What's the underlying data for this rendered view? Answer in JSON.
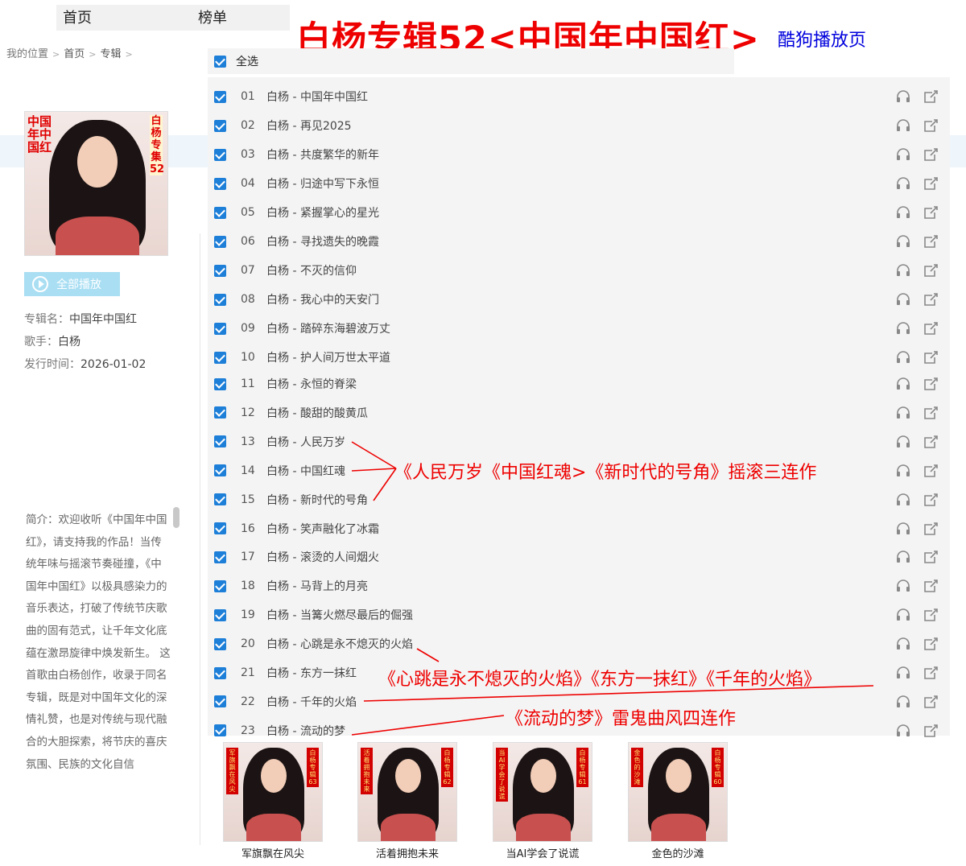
{
  "nav": {
    "home": "首页",
    "charts": "榜单"
  },
  "header": {
    "title": "白杨专辑52<中国年中国红>",
    "page_tag": "酷狗播放页"
  },
  "breadcrumb": {
    "location": "我的位置",
    "home": "首页",
    "album": "专辑",
    "sep": ">"
  },
  "cover": {
    "left_text": "中国年中国红",
    "right_text": "白杨专集52"
  },
  "play_all": "全部播放",
  "album_info": {
    "name_label": "专辑名：",
    "name": "中国年中国红",
    "singer_label": "歌手：",
    "singer": "白杨",
    "release_label": "发行时间：",
    "release": "2026-01-02"
  },
  "intro": "简介：欢迎收听《中国年中国红》，请支持我的作品！当传统年味与摇滚节奏碰撞，《中国年中国红》以极具感染力的音乐表达，打破了传统节庆歌曲的固有范式，让千年文化底蕴在激昂旋律中焕发新生。 这首歌由白杨创作，收录于同名专辑，既是对中国年文化的深情礼赞，也是对传统与现代融合的大胆探索，将节庆的喜庆氛围、民族的文化自信",
  "select_all": "全选",
  "songs": [
    {
      "num": "01",
      "title": "白杨 - 中国年中国红"
    },
    {
      "num": "02",
      "title": "白杨 - 再见2025"
    },
    {
      "num": "03",
      "title": "白杨 - 共度繁华的新年"
    },
    {
      "num": "04",
      "title": "白杨 - 归途中写下永恒"
    },
    {
      "num": "05",
      "title": "白杨 - 紧握掌心的星光"
    },
    {
      "num": "06",
      "title": "白杨 - 寻找遗失的晚霞"
    },
    {
      "num": "07",
      "title": "白杨 - 不灭的信仰"
    },
    {
      "num": "08",
      "title": "白杨 - 我心中的天安门"
    },
    {
      "num": "09",
      "title": "白杨 - 踏碎东海碧波万丈"
    },
    {
      "num": "10",
      "title": "白杨 - 护人间万世太平道"
    },
    {
      "num": "11",
      "title": "白杨 - 永恒的脊梁"
    },
    {
      "num": "12",
      "title": "白杨 - 酸甜的酸黄瓜"
    },
    {
      "num": "13",
      "title": "白杨 - 人民万岁"
    },
    {
      "num": "14",
      "title": "白杨 - 中国红魂"
    },
    {
      "num": "15",
      "title": "白杨 - 新时代的号角"
    },
    {
      "num": "16",
      "title": "白杨 - 笑声融化了冰霜"
    },
    {
      "num": "17",
      "title": "白杨 - 滚烫的人间烟火"
    },
    {
      "num": "18",
      "title": "白杨 - 马背上的月亮"
    },
    {
      "num": "19",
      "title": "白杨 - 当篝火燃尽最后的倔强"
    },
    {
      "num": "20",
      "title": "白杨 - 心跳是永不熄灭的火焰"
    },
    {
      "num": "21",
      "title": "白杨 - 东方一抹红"
    },
    {
      "num": "22",
      "title": "白杨 - 千年的火焰"
    },
    {
      "num": "23",
      "title": "白杨 - 流动的梦"
    }
  ],
  "annotations": {
    "rock_trilogy": "《人民万岁《中国红魂>《新时代的号角》摇滚三连作",
    "fire_trio": "《心跳是永不熄灭的火焰》《东方一抹红》《千年的火焰》",
    "ghost_quad": "《流动的梦》雷鬼曲风四连作"
  },
  "related_albums": [
    {
      "title": "军旗飘在风尖",
      "left": "军旗飘在风尖",
      "right": "白杨专辑63"
    },
    {
      "title": "活着拥抱未来",
      "left": "活着拥抱未来",
      "right": "白杨专辑62"
    },
    {
      "title": "当AI学会了说谎",
      "left": "当AI学会了说谎",
      "right": "白杨专辑61"
    },
    {
      "title": "金色的沙滩",
      "left": "金色的沙滩",
      "right": "白杨专辑60"
    }
  ],
  "colors": {
    "accent": "#1e7fd8",
    "annotation": "#ee0000",
    "page_tag": "#0000dd",
    "play_button": "#a9def3"
  }
}
